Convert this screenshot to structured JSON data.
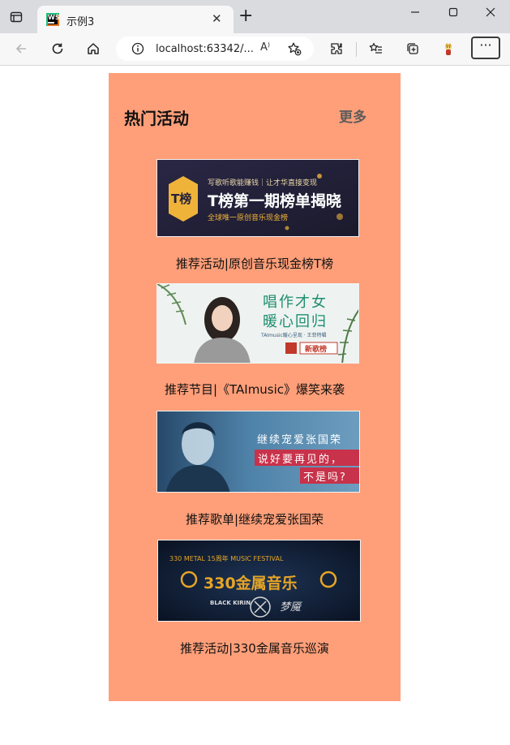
{
  "browser": {
    "tab_title": "示例3",
    "tab_favicon_text": "WS",
    "url": "localhost:63342/...",
    "read_aloud": "A⁾"
  },
  "section": {
    "title": "热门活动",
    "more_label": "更多"
  },
  "items": [
    {
      "caption": "推荐活动|原创音乐现金榜T榜",
      "banner": {
        "kind": "t-chart",
        "logo": "T榜",
        "line1": "写歌听歌能赚钱｜让才华直接变现",
        "headline": "T榜第一期榜单揭晓",
        "line3": "全球唯一原创音乐现金榜",
        "bg": "#24213a",
        "accent": "#f0b33a"
      }
    },
    {
      "caption": "推荐节目|《TAImusic》爆笑来袭",
      "banner": {
        "kind": "singer",
        "headline1": "唱作才女",
        "headline2": "暖心回归",
        "sub": "TAImusic暖心呈现 · 王菲特辑",
        "badge": "新歌榜",
        "bg": "#eef3f1",
        "accent": "#1e8e6e"
      }
    },
    {
      "caption": "推荐歌单|继续宠爱张国荣",
      "banner": {
        "kind": "playlist",
        "line1": "继续宠爱张国荣",
        "line2": "说好要再见的，",
        "line3": "不是吗?",
        "bg": "#3d6b8e",
        "accent": "#c8324a"
      }
    },
    {
      "caption": "推荐活动|330金属音乐巡演",
      "banner": {
        "kind": "metal",
        "top": "330 METAL 15周年 MUSIC FESTIVAL",
        "headline": "330金属音乐",
        "bands": [
          "BLACK KIRIN",
          "梦魇"
        ],
        "bg": "#0f1a2e",
        "accent": "#e6a526"
      }
    }
  ]
}
